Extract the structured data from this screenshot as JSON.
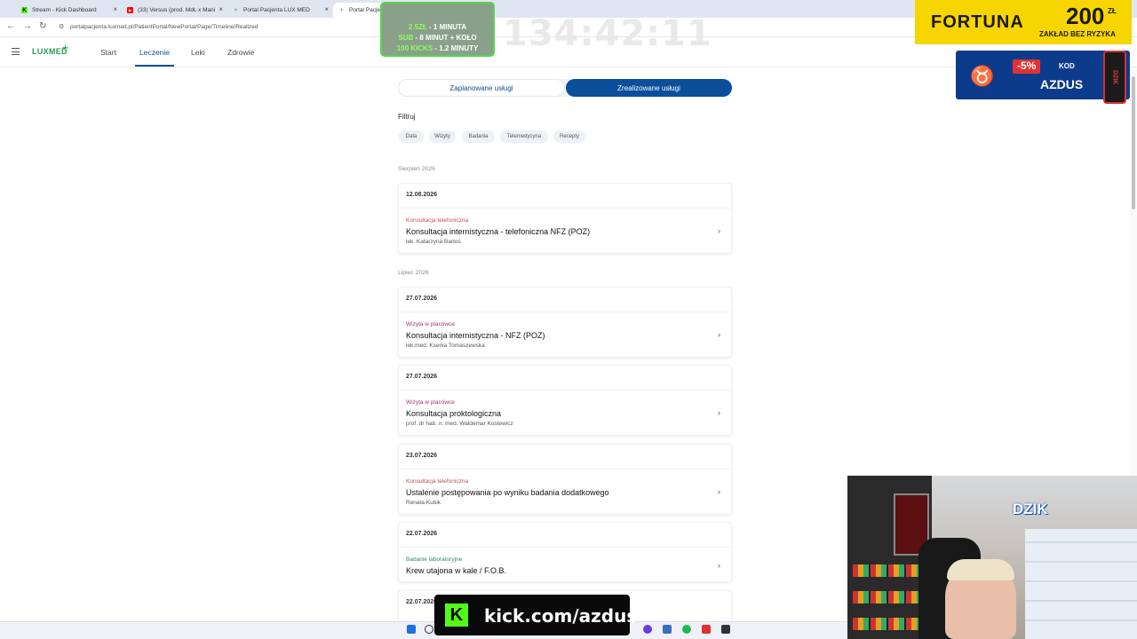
{
  "browser": {
    "tabs": [
      {
        "title": "Stream - Kick Dashboard",
        "favicon_color": "#53fc18",
        "favicon_glyph": "K",
        "active": false
      },
      {
        "title": "(33) Versus (prod. MdL x Mani",
        "favicon_color": "#ff0000",
        "favicon_glyph": "▶",
        "active": false
      },
      {
        "title": "Portal Pacjenta LUX MED",
        "favicon_color": "#36b35a",
        "favicon_glyph": "+",
        "active": false
      },
      {
        "title": "Portal Pacjenta LUX MED",
        "favicon_color": "#36b35a",
        "favicon_glyph": "+",
        "active": true
      }
    ],
    "close_glyph": "×",
    "new_tab_glyph": "+",
    "back_glyph": "←",
    "forward_glyph": "→",
    "reload_glyph": "↻",
    "site_info_glyph": "⚙",
    "url": "portalpacjenta.luxmed.pl/PatientPortal/NewPortal/Page/Timeline/Realized"
  },
  "header": {
    "logo": "LUXMED",
    "logo_icon": "+",
    "nav": [
      "Start",
      "Leczenie",
      "Leki",
      "Zdrowie"
    ],
    "active_nav": "Leczenie"
  },
  "main": {
    "toggle": {
      "planned": "Zaplanowane usługi",
      "realized": "Zrealizowane usługi"
    },
    "filters_title": "Filtruj",
    "filters": [
      "Data",
      "Wizyty",
      "Badania",
      "Telemedycyna",
      "Recepty"
    ],
    "months": [
      "Sierpień 2026",
      "Lipiec 2026"
    ],
    "cards": [
      {
        "date": "12.08.2026",
        "type": "Konsultacja telefoniczna",
        "type_color": "#c0504d",
        "title": "Konsultacja internistyczna - telefoniczna NFZ (POZ)",
        "doctor": "lek. Katarzyna Bartoś"
      },
      {
        "date": "27.07.2026",
        "type": "Wizyta w placówce",
        "type_color": "#a0307a",
        "title": "Konsultacja internistyczna - NFZ (POZ)",
        "doctor": "lek.med. Ksenia Tomaszewska"
      },
      {
        "date": "27.07.2026",
        "type": "Wizyta w placówce",
        "type_color": "#a0307a",
        "title": "Konsultacja proktologiczna",
        "doctor": "prof. dr hab. n. med. Waldemar Kostewicz"
      },
      {
        "date": "23.07.2026",
        "type": "Konsultacja telefoniczna",
        "type_color": "#c0504d",
        "title": "Ustalenie postępowania po wyniku badania dodatkowego",
        "doctor": "Renata Kubik"
      },
      {
        "date": "22.07.2026",
        "type": "Badanie laboratoryjne",
        "type_color": "#2e8b57",
        "title": "Krew utajona w kale / F.O.B.",
        "doctor": ""
      },
      {
        "date": "22.07.2026",
        "type": "",
        "type_color": "#2e8b57",
        "title": "",
        "doctor": ""
      }
    ],
    "chevron_glyph": "›"
  },
  "overlays": {
    "sub_goal": {
      "line1_amount": "2.5ZŁ",
      "line1_rest": " - 1 MINUTA",
      "line2_amount": "SUB",
      "line2_rest": " - 8 MINUT + KOŁO",
      "line3_amount": "100 KICKS",
      "line3_rest": " - 1.2 MINUTY"
    },
    "timer": "134:42:11",
    "fortuna": {
      "name": "FORTUNA",
      "amount": "200",
      "currency": "ZŁ",
      "tag": "ZAKŁAD BEZ RYZYKA"
    },
    "azdus_promo": {
      "discount": "-5%",
      "kod_label": "KOD",
      "code": "AZDUS",
      "can_label": "DZIK"
    },
    "webcam_logo": "DZIK",
    "kick_banner": {
      "glyph": "K",
      "url": "kick.com/azdus"
    }
  },
  "colors": {
    "brand_blue": "#0b4f9a",
    "brand_green": "#36b35a",
    "kick_green": "#53fc18"
  }
}
